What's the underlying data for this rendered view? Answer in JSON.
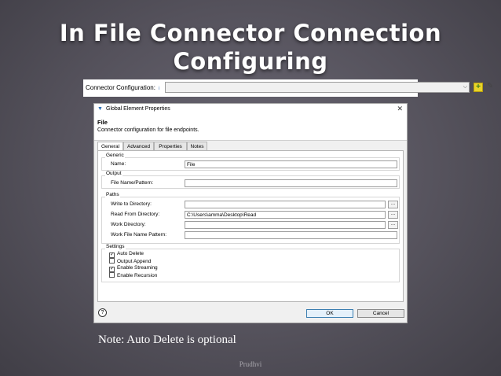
{
  "slide": {
    "title_line1": "In File Connector Connection",
    "title_line2": "Configuring",
    "note": "Note: Auto Delete is optional",
    "footer": "Prudhvi"
  },
  "connector_bar": {
    "label": "Connector Configuration:",
    "info_icon": "info-icon",
    "value": "",
    "add_icon": "plus-icon",
    "edit_icon": "edit-icon"
  },
  "dialog": {
    "title": "Global Element Properties",
    "header_title": "File",
    "header_subtitle": "Connector configuration for file endpoints.",
    "tabs": [
      "General",
      "Advanced",
      "Properties",
      "Notes"
    ],
    "active_tab": "General",
    "groups": {
      "generic": {
        "label": "Generic",
        "name_label": "Name:",
        "name_value": "File"
      },
      "output": {
        "label": "Output",
        "pattern_label": "File Name/Pattern:",
        "pattern_value": ""
      },
      "paths": {
        "label": "Paths",
        "write_label": "Write to Directory:",
        "write_value": "",
        "read_label": "Read From Directory:",
        "read_value": "C:\\Users\\amma\\Desktop\\Read",
        "work_label": "Work Directory:",
        "work_value": "",
        "pattern_label": "Work File Name Pattern:",
        "pattern_value": "",
        "browse_label": "..."
      },
      "settings": {
        "label": "Settings",
        "options": [
          {
            "label": "Auto Delete",
            "checked": true
          },
          {
            "label": "Output Append",
            "checked": false
          },
          {
            "label": "Enable Streaming",
            "checked": true
          },
          {
            "label": "Enable Recursion",
            "checked": false
          }
        ]
      }
    },
    "ok_label": "OK",
    "cancel_label": "Cancel",
    "help_label": "?"
  }
}
